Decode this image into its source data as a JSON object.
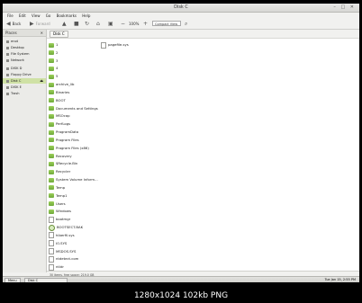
{
  "window": {
    "title": "Disk C"
  },
  "menu": [
    "File",
    "Edit",
    "View",
    "Go",
    "Bookmarks",
    "Help"
  ],
  "toolbar": {
    "back_label": "Back",
    "forward_label": "Forward",
    "zoom_level": "100%",
    "view_mode": "Compact View"
  },
  "sidebar": {
    "heading": "Places",
    "items": [
      {
        "label": "enot",
        "selected": false
      },
      {
        "label": "Desktop",
        "selected": false
      },
      {
        "label": "File System",
        "selected": false
      },
      {
        "label": "Network",
        "selected": false
      },
      {
        "label": "DISK D",
        "selected": false
      },
      {
        "label": "Floppy Drive",
        "selected": false
      },
      {
        "label": "Disk C",
        "selected": true
      },
      {
        "label": "DISK E",
        "selected": false
      },
      {
        "label": "Trash",
        "selected": false
      }
    ]
  },
  "pathbar": {
    "crumb": "Disk C"
  },
  "files_col1": [
    {
      "name": "1",
      "type": "folder"
    },
    {
      "name": "2",
      "type": "folder"
    },
    {
      "name": "3",
      "type": "folder"
    },
    {
      "name": "4",
      "type": "folder"
    },
    {
      "name": "5",
      "type": "folder"
    },
    {
      "name": "archive_lib",
      "type": "folder"
    },
    {
      "name": "Binaries",
      "type": "folder"
    },
    {
      "name": "BOOT",
      "type": "folder"
    },
    {
      "name": "Documents and Settings",
      "type": "folder"
    },
    {
      "name": "MSOcap",
      "type": "folder"
    },
    {
      "name": "PerfLogs",
      "type": "folder"
    },
    {
      "name": "ProgramData",
      "type": "folder"
    },
    {
      "name": "Program Files",
      "type": "folder"
    },
    {
      "name": "Program Files (x86)",
      "type": "folder"
    },
    {
      "name": "Recovery",
      "type": "folder"
    },
    {
      "name": "$Recycle.Bin",
      "type": "folder"
    },
    {
      "name": "Recycler",
      "type": "folder"
    },
    {
      "name": "System Volume Inform...",
      "type": "folder"
    },
    {
      "name": "Temp",
      "type": "folder"
    },
    {
      "name": "Temp1",
      "type": "folder"
    },
    {
      "name": "Users",
      "type": "folder"
    },
    {
      "name": "Windows",
      "type": "folder"
    },
    {
      "name": "bootmgr",
      "type": "doc"
    },
    {
      "name": "BOOTSECT.BAK",
      "type": "gear"
    },
    {
      "name": "hiberfil.sys",
      "type": "doc"
    },
    {
      "name": "IO.SYS",
      "type": "doc"
    },
    {
      "name": "MSDOS.SYS",
      "type": "doc"
    },
    {
      "name": "ntdetect.com",
      "type": "doc"
    },
    {
      "name": "ntldr",
      "type": "doc"
    }
  ],
  "files_col2": [
    {
      "name": "pagefile.sys",
      "type": "doc"
    }
  ],
  "status": {
    "text": "30 items, free space: 219.0 GB"
  },
  "taskbar": {
    "menu_label": "Menu",
    "task_label": "Disk C",
    "clock": "Tue Jan 15, 2:55 PM"
  },
  "caption": "1280x1024  102kb  PNG"
}
